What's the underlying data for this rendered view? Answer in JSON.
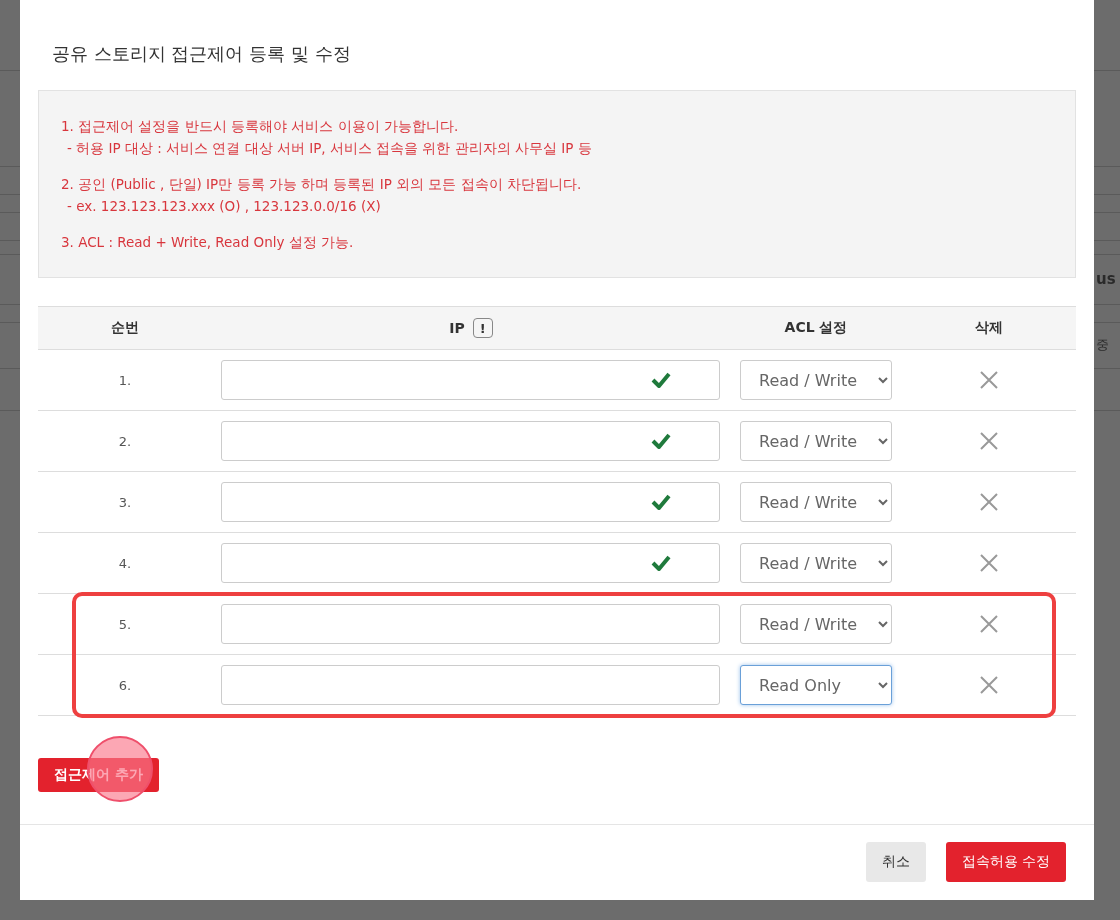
{
  "background_fragments": [
    "us",
    "중"
  ],
  "dialog": {
    "title": "공유 스토리지 접근제어 등록 및 수정",
    "notice": [
      {
        "kind": "item",
        "text": "1. 접근제어 설정을 반드시 등록해야 서비스 이용이 가능합니다."
      },
      {
        "kind": "sub",
        "text": "- 허용 IP 대상 : 서비스 연결 대상 서버 IP, 서비스 접속을 위한 관리자의 사무실 IP 등"
      },
      {
        "kind": "item",
        "text": "2. 공인 (Public , 단일) IP만 등록 가능 하며 등록된 IP 외의 모든 접속이 차단됩니다."
      },
      {
        "kind": "sub",
        "text": "- ex. 123.123.123.xxx (O) , 123.123.0.0/16 (X)"
      },
      {
        "kind": "item",
        "text": "3. ACL : Read + Write, Read Only 설정 가능."
      }
    ],
    "table": {
      "columns": [
        "순번",
        "IP",
        "ACL 설정",
        "삭제"
      ],
      "ip_hint_icon": "!",
      "rows": [
        {
          "number": "1.",
          "valid": true,
          "acl": "Read / Write",
          "focused": false,
          "highlighted": false
        },
        {
          "number": "2.",
          "valid": true,
          "acl": "Read / Write",
          "focused": false,
          "highlighted": false
        },
        {
          "number": "3.",
          "valid": true,
          "acl": "Read / Write",
          "focused": false,
          "highlighted": false
        },
        {
          "number": "4.",
          "valid": true,
          "acl": "Read / Write",
          "focused": false,
          "highlighted": false
        },
        {
          "number": "5.",
          "valid": false,
          "acl": "Read / Write",
          "focused": false,
          "highlighted": true
        },
        {
          "number": "6.",
          "valid": false,
          "acl": "Read Only",
          "focused": true,
          "highlighted": true
        }
      ]
    },
    "add_button": {
      "label": "접근제어 추가",
      "touched": true
    },
    "footer_buttons": [
      {
        "kind": "secondary",
        "label": "취소"
      },
      {
        "kind": "primary",
        "label": "접속허용 수정"
      }
    ]
  }
}
